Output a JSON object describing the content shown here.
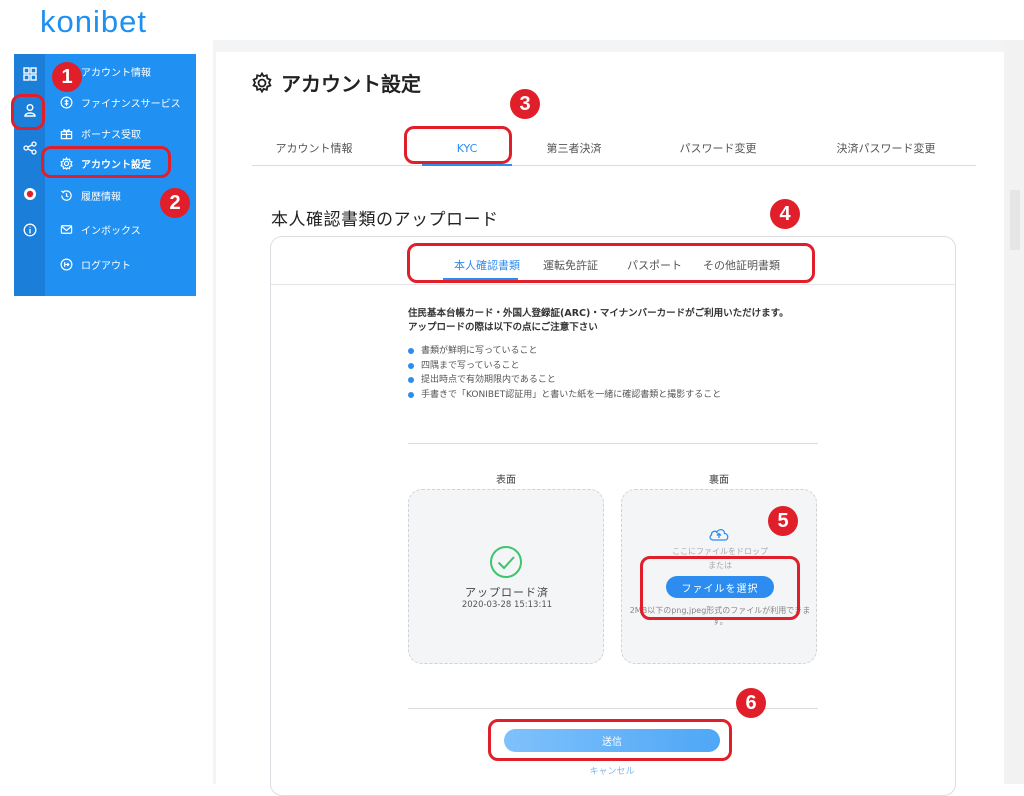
{
  "app": {
    "logo_text": "konibet"
  },
  "sidebar": {
    "items": [
      {
        "label": "アカウント情報",
        "icon": "account-info-icon"
      },
      {
        "label": "ファイナンスサービス",
        "icon": "finance-icon"
      },
      {
        "label": "ボーナス受取",
        "icon": "bonus-icon"
      },
      {
        "label": "アカウント設定",
        "icon": "gear-icon",
        "active": true
      },
      {
        "label": "履歴情報",
        "icon": "history-icon"
      },
      {
        "label": "インボックス",
        "icon": "mail-icon"
      },
      {
        "label": "ログアウト",
        "icon": "logout-icon"
      }
    ],
    "rail_icons": [
      "grid-icon",
      "user-icon",
      "share-icon",
      "record-icon",
      "info-icon"
    ]
  },
  "page": {
    "title": "アカウント設定",
    "tabs": [
      "アカウント情報",
      "KYC",
      "第三者決済",
      "パスワード変更",
      "決済パスワード変更"
    ],
    "active_tab": "KYC"
  },
  "kyc": {
    "section_title": "本人確認書類のアップロード",
    "doc_tabs": [
      "本人確認書類",
      "運転免許証",
      "パスポート",
      "その他証明書類"
    ],
    "active_doc_tab": "本人確認書類",
    "notice_line1": "住民基本台帳カード・外国人登録証(ARC)・マイナンバーカードがご利用いただけます。",
    "notice_line2": "アップロードの際は以下の点にご注意下さい",
    "bullets": [
      "書類が鮮明に写っていること",
      "四隅まで写っていること",
      "提出時点で有効期限内であること",
      "手書きで「KONIBET認証用」と書いた紙を一緒に確認書類と撮影すること"
    ],
    "front": {
      "label": "表面",
      "status": "アップロード済",
      "timestamp": "2020-03-28 15:13:11"
    },
    "back": {
      "label": "裏面",
      "drop_text": "ここにファイルをドロップ",
      "or_text": "または",
      "button": "ファイルを選択",
      "hint": "2MB以下のpng,jpeg形式のファイルが利用できます。"
    },
    "submit": "送信",
    "cancel": "キャンセル"
  },
  "annotations": [
    "1",
    "2",
    "3",
    "4",
    "5",
    "6"
  ],
  "colors": {
    "brand": "#2090f2",
    "accent": "#2d8cf0",
    "annotation": "#e01f2a"
  }
}
